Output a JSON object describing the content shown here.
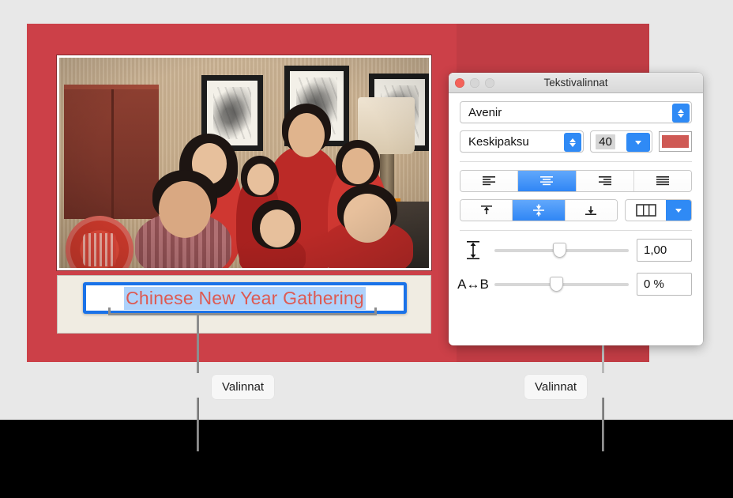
{
  "slide": {
    "caption_text": "Chinese New Year Gathering",
    "photo_alt": "family-photo"
  },
  "callouts": {
    "left_label": "Valinnat",
    "right_label": "Valinnat"
  },
  "panel": {
    "title": "Tekstivalinnat",
    "window_buttons": [
      "close-button",
      "minimize-button",
      "zoom-button"
    ],
    "font": {
      "family": "Avenir",
      "weight": "Keskipaksu",
      "size": "40",
      "color_hex": "#cf5a55"
    },
    "alignment": {
      "options": [
        "align-left",
        "align-center",
        "align-right",
        "align-justify"
      ],
      "selected_index": 1
    },
    "vertical_alignment": {
      "options": [
        "valign-top",
        "valign-middle",
        "valign-bottom"
      ],
      "selected_index": 1
    },
    "columns": {
      "icon": "columns-icon",
      "label": ""
    },
    "spacing": {
      "line_icon": "line-spacing-icon",
      "line_value": "1,00",
      "char_icon": "A↔B",
      "char_value": "0 %"
    }
  },
  "colors": {
    "slide_red": "#cc4048",
    "accent_blue": "#2f8af5",
    "selection_blue": "#aed2fb",
    "caption_red": "#dd5a52"
  }
}
